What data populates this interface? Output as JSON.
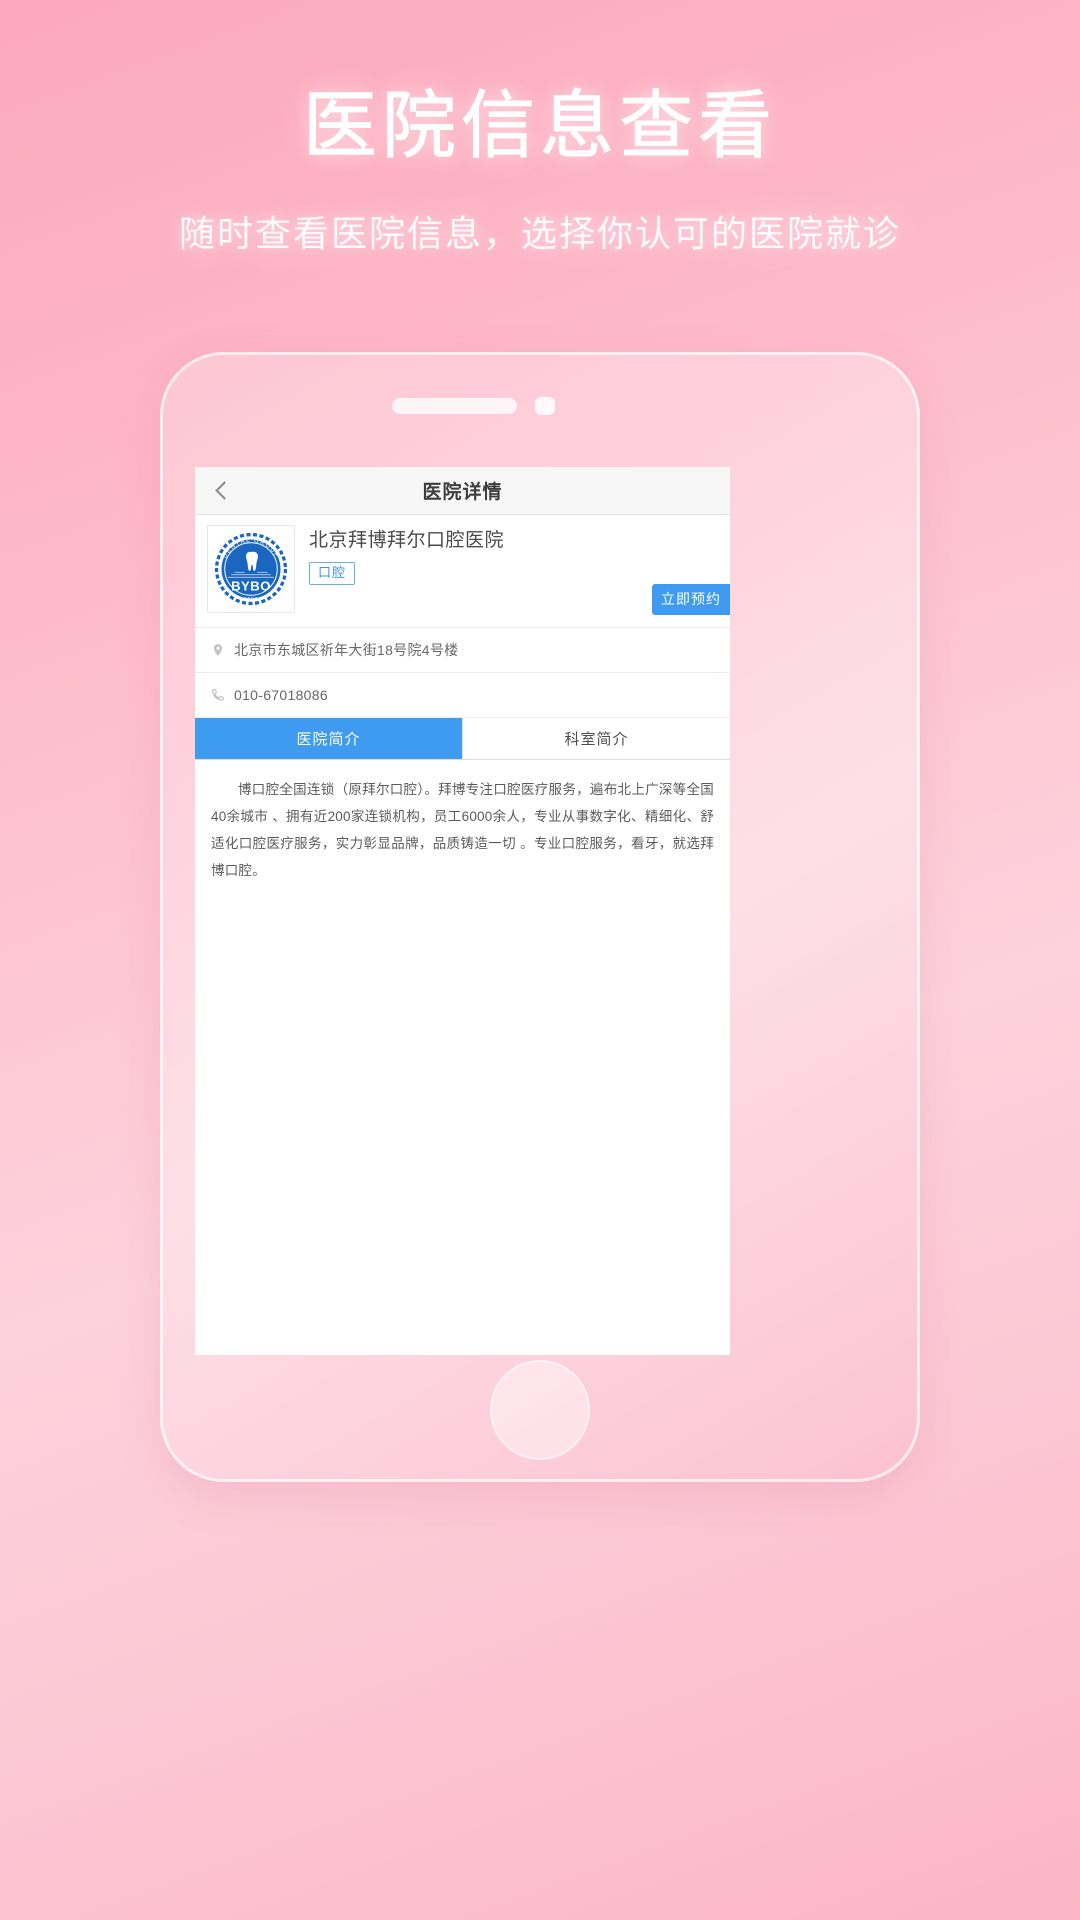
{
  "promo": {
    "title": "医院信息查看",
    "subtitle": "随时查看医院信息，选择你认可的医院就诊"
  },
  "phone": {
    "speaker_name": "speaker-grille",
    "camera_name": "front-camera",
    "home_button_name": "home-button"
  },
  "app": {
    "navbar": {
      "back_icon": "chevron-left-icon",
      "title": "医院详情"
    },
    "hospital": {
      "name": "北京拜博拜尔口腔医院",
      "tag": "口腔",
      "book_button": "立即预约",
      "logo": {
        "icon_name": "bybo-dental-logo",
        "arc_text": "DENTAL GROUP",
        "brand": "BYBO",
        "year": "1993",
        "color": "#1a66c0"
      }
    },
    "info": [
      {
        "icon": "location-pin-icon",
        "text": "北京市东城区祈年大街18号院4号楼"
      },
      {
        "icon": "phone-handset-icon",
        "text": "010-67018086"
      }
    ],
    "tabs": [
      {
        "label": "医院简介",
        "active": true
      },
      {
        "label": "科室简介",
        "active": false
      }
    ],
    "description": "博口腔全国连锁（原拜尔口腔）。拜博专注口腔医疗服务，遍布北上广深等全国40余城市 、拥有近200家连锁机构，员工6000余人，专业从事数字化、精细化、舒适化口腔医疗服务，实力彰显品牌，品质铸造一切 。专业口腔服务，看牙，就选拜博口腔。"
  },
  "colors": {
    "brand_blue": "#3e9bf0",
    "tag_blue": "#3d93ef",
    "bg_pink_top": "#fca8bd",
    "bg_pink_mid": "#fdd2dc"
  }
}
